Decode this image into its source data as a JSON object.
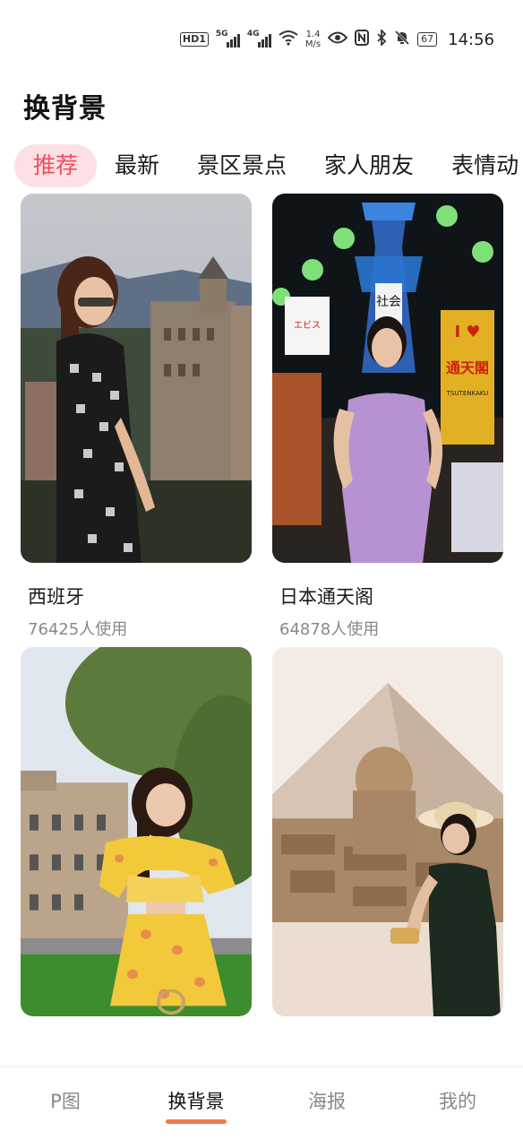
{
  "status_bar": {
    "hd_badge": "HD1",
    "network_5g": "5G",
    "network_4g": "4G",
    "speed_value": "1.4",
    "speed_unit": "M/s",
    "battery": "67",
    "time": "14:56"
  },
  "header": {
    "title": "换背景"
  },
  "tabs": [
    {
      "label": "推荐",
      "active": true
    },
    {
      "label": "最新"
    },
    {
      "label": "景区景点"
    },
    {
      "label": "家人朋友"
    },
    {
      "label": "表情动"
    }
  ],
  "cards": [
    {
      "title": "西班牙",
      "usage": "76425人使用"
    },
    {
      "title": "日本通天阁",
      "usage": "64878人使用"
    },
    {
      "title": "",
      "usage": ""
    },
    {
      "title": "",
      "usage": ""
    }
  ],
  "card_signs": {
    "tower_sign": "社会",
    "sign_love": "I ♥",
    "sign_tsutenkaku": "通天閣",
    "sign_roman": "TSUTENKAKU",
    "sign_ebisu": "エビス"
  },
  "bottom_nav": [
    {
      "label": "P图"
    },
    {
      "label": "换背景",
      "active": true
    },
    {
      "label": "海报"
    },
    {
      "label": "我的"
    }
  ]
}
